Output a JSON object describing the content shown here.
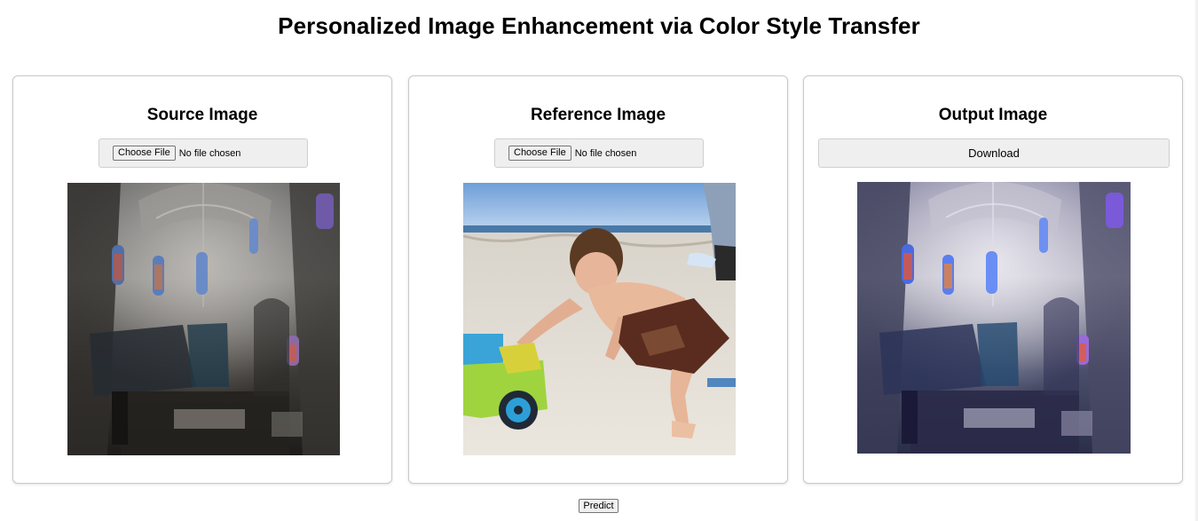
{
  "page": {
    "title": "Personalized Image Enhancement via Color Style Transfer"
  },
  "source": {
    "heading": "Source Image",
    "choose_label": "Choose File",
    "status": "No file chosen"
  },
  "reference": {
    "heading": "Reference Image",
    "choose_label": "Choose File",
    "status": "No file chosen"
  },
  "output": {
    "heading": "Output Image",
    "download_label": "Download"
  },
  "actions": {
    "predict_label": "Predict"
  },
  "colors": {
    "panel_border": "#c9c9c9",
    "button_bg": "#efefef"
  }
}
